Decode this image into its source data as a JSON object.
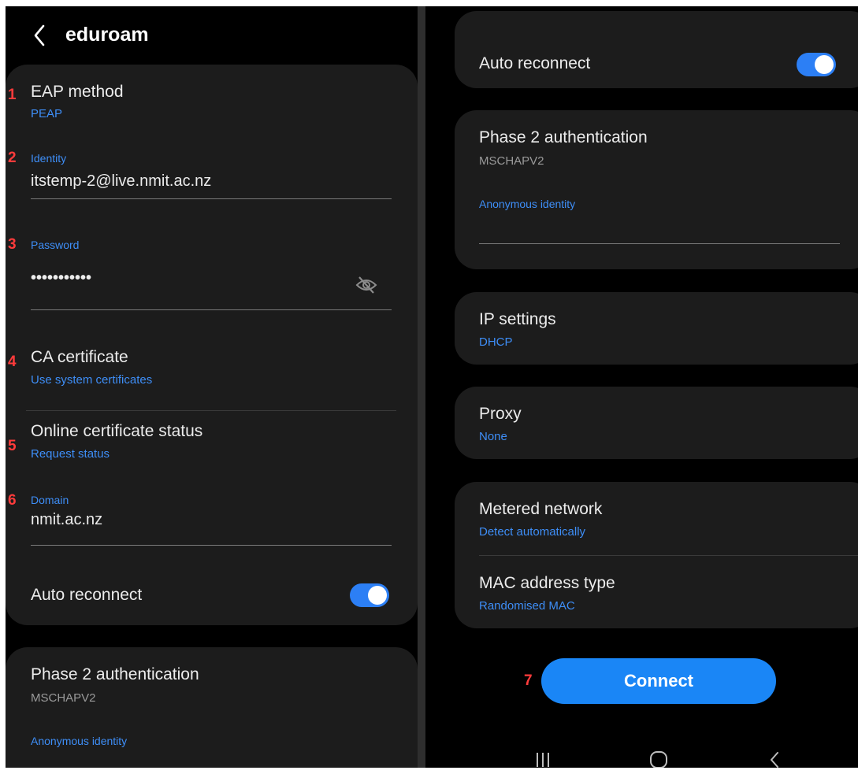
{
  "header": {
    "title": "eduroam"
  },
  "left": {
    "eap": {
      "number": "1",
      "title": "EAP method",
      "value": "PEAP"
    },
    "identity": {
      "number": "2",
      "label": "Identity",
      "value": "itstemp-2@live.nmit.ac.nz"
    },
    "password": {
      "number": "3",
      "label": "Password",
      "value": "•••••••••••"
    },
    "ca": {
      "number": "4",
      "title": "CA certificate",
      "value": "Use system certificates"
    },
    "ocsp": {
      "number": "5",
      "title": "Online certificate status",
      "value": "Request status"
    },
    "domain": {
      "number": "6",
      "label": "Domain",
      "value": "nmit.ac.nz"
    },
    "auto_reconnect": {
      "label": "Auto reconnect",
      "on": true
    },
    "phase2": {
      "title": "Phase 2 authentication",
      "value": "MSCHAPV2"
    },
    "anonymous": {
      "label": "Anonymous identity"
    }
  },
  "right": {
    "auto_reconnect": {
      "label": "Auto reconnect",
      "on": true
    },
    "phase2": {
      "title": "Phase 2 authentication",
      "value": "MSCHAPV2"
    },
    "anonymous": {
      "label": "Anonymous identity",
      "value": ""
    },
    "ip": {
      "title": "IP settings",
      "value": "DHCP"
    },
    "proxy": {
      "title": "Proxy",
      "value": "None"
    },
    "metered": {
      "title": "Metered network",
      "value": "Detect automatically"
    },
    "mac": {
      "title": "MAC address type",
      "value": "Randomised MAC"
    },
    "connect": {
      "number": "7",
      "label": "Connect"
    }
  },
  "nav": {
    "recent": "recent-apps-icon",
    "home": "home-icon",
    "back": "back-icon"
  },
  "colors": {
    "accent": "#3e8ef7",
    "card": "#1c1c1c",
    "background": "#000000",
    "annotation": "#ff3b3b",
    "button": "#1a86f6"
  }
}
